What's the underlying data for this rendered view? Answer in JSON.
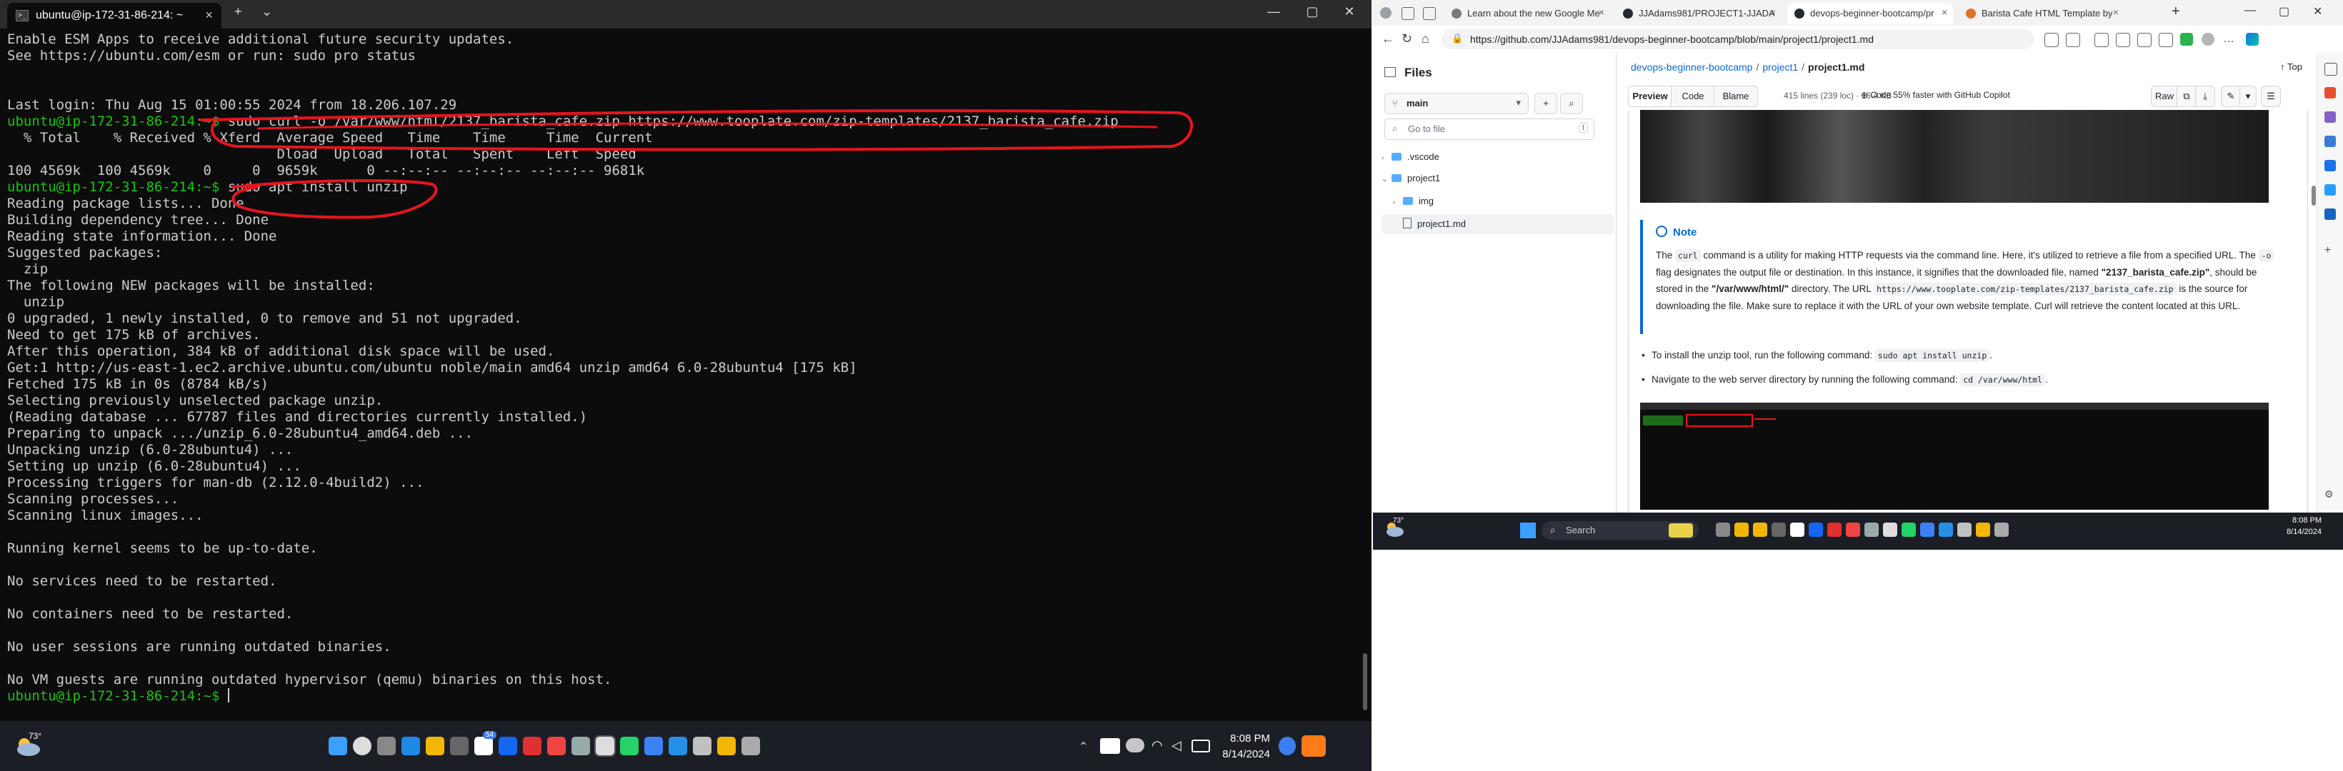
{
  "terminal": {
    "tab_title": "ubuntu@ip-172-31-86-214: ~",
    "tab_close": "×",
    "new_tab": "+",
    "dropdown": "⌄",
    "win_min": "—",
    "win_max": "▢",
    "win_close": "✕",
    "lines": [
      "Enable ESM Apps to receive additional future security updates.",
      "See https://ubuntu.com/esm or run: sudo pro status",
      "",
      "",
      "Last login: Thu Aug 15 01:00:55 2024 from 18.206.107.29",
      "ubuntu@ip-172-31-86-214:~$ sudo curl -o /var/www/html/2137_barista_cafe.zip https://www.tooplate.com/zip-templates/2137_barista_cafe.zip",
      "  % Total    % Received % Xferd  Average Speed   Time    Time     Time  Current",
      "                                 Dload  Upload   Total   Spent    Left  Speed",
      "100 4569k  100 4569k    0     0  9659k      0 --:--:-- --:--:-- --:--:-- 9681k",
      "ubuntu@ip-172-31-86-214:~$ sudo apt install unzip",
      "Reading package lists... Done",
      "Building dependency tree... Done",
      "Reading state information... Done",
      "Suggested packages:",
      "  zip",
      "The following NEW packages will be installed:",
      "  unzip",
      "0 upgraded, 1 newly installed, 0 to remove and 51 not upgraded.",
      "Need to get 175 kB of archives.",
      "After this operation, 384 kB of additional disk space will be used.",
      "Get:1 http://us-east-1.ec2.archive.ubuntu.com/ubuntu noble/main amd64 unzip amd64 6.0-28ubuntu4 [175 kB]",
      "Fetched 175 kB in 0s (8784 kB/s)",
      "Selecting previously unselected package unzip.",
      "(Reading database ... 67787 files and directories currently installed.)",
      "Preparing to unpack .../unzip_6.0-28ubuntu4_amd64.deb ...",
      "Unpacking unzip (6.0-28ubuntu4) ...",
      "Setting up unzip (6.0-28ubuntu4) ...",
      "Processing triggers for man-db (2.12.0-4build2) ...",
      "Scanning processes...",
      "Scanning linux images...",
      "",
      "Running kernel seems to be up-to-date.",
      "",
      "No services need to be restarted.",
      "",
      "No containers need to be restarted.",
      "",
      "No user sessions are running outdated binaries.",
      "",
      "No VM guests are running outdated hypervisor (qemu) binaries on this host.",
      "ubuntu@ip-172-31-86-214:~$ "
    ],
    "prompt": "ubuntu@ip-172-31-86-214:~$"
  },
  "taskbar_left": {
    "weather_temp": "73°",
    "time": "8:08 PM",
    "date": "8/14/2024",
    "badge_count": "54",
    "icons": [
      "start-icon",
      "search-icon",
      "task-view-icon",
      "edge-icon",
      "file-explorer-icon",
      "store-icon",
      "amazon-icon",
      "dropbox-icon",
      "red-app-icon",
      "chrome-icon",
      "settings-icon",
      "terminal-icon",
      "whatsapp-icon",
      "notepad-icon",
      "vscode-icon",
      "virtualbox-icon",
      "sticky-icon",
      "snip-icon"
    ]
  },
  "browser": {
    "tabs": [
      {
        "title": "Learn about the new Google Me",
        "color": "#7a7a7a"
      },
      {
        "title": "JJAdams981/PROJECT1-JJADAMS",
        "color": "#24292f"
      },
      {
        "title": "devops-beginner-bootcamp/pr",
        "color": "#24292f"
      },
      {
        "title": "Barista Cafe HTML Template by",
        "color": "#e0722a"
      }
    ],
    "new_tab": "+",
    "url": "https://github.com/JJAdams981/devops-beginner-bootcamp/blob/main/project1/project1.md",
    "win_min": "—",
    "win_max": "▢",
    "win_close": "✕"
  },
  "github": {
    "files_header": "Files",
    "branch": "main",
    "go_to_file": "Go to file",
    "shortcut": "t",
    "tree": [
      {
        "label": ".vscode",
        "type": "folder",
        "chev": "›"
      },
      {
        "label": "project1",
        "type": "folder",
        "chev": "⌄"
      },
      {
        "label": "img",
        "type": "folder",
        "chev": "›"
      },
      {
        "label": "project1.md",
        "type": "file",
        "chev": ""
      }
    ],
    "crumbs": {
      "repo": "devops-beginner-bootcamp",
      "folder": "project1",
      "file": "project1.md"
    },
    "top_label": "↑ Top",
    "views": [
      "Preview",
      "Code",
      "Blame"
    ],
    "meta": "415 lines (239 loc) · 16.4 KB",
    "copilot": "Code 55% faster with GitHub Copilot",
    "raw": "Raw",
    "note_title": "Note",
    "note": {
      "p1": "The ",
      "c1": "curl",
      "p2": " command is a utility for making HTTP requests via the command line. Here, it's utilized to retrieve a file from a specified URL. The ",
      "c2": "-o",
      "p3": " flag designates the output file or destination. In this instance, it signifies that the downloaded file, named ",
      "b1": "\"2137_barista_cafe.zip\"",
      "p4": ", should be stored in the ",
      "b2": "\"/var/www/html/\"",
      "p5": " directory. The URL ",
      "c3": "https://www.tooplate.com/zip-templates/2137_barista_cafe.zip",
      "p6": " is the source for downloading the file. Make sure to replace it with the URL of your own website template. Curl will retrieve the content located at this URL."
    },
    "bullet1_text": "To install the unzip tool, run the following command: ",
    "bullet1_code": "sudo apt install unzip",
    "bullet1_end": ".",
    "bullet2_text": "Navigate to the web server directory by running the following command: ",
    "bullet2_code": "cd /var/www/html",
    "bullet2_end": "."
  },
  "taskbar_right": {
    "weather_temp": "73°",
    "search_placeholder": "Search",
    "time": "8:08 PM",
    "date": "8/14/2024",
    "badge_count": "54"
  },
  "colors": {
    "terminal_bg": "#0c0c0c",
    "prompt_green": "#16c60c",
    "annotation_red": "#e8141e",
    "github_link": "#0969da",
    "taskbar": "#1c1e26"
  }
}
